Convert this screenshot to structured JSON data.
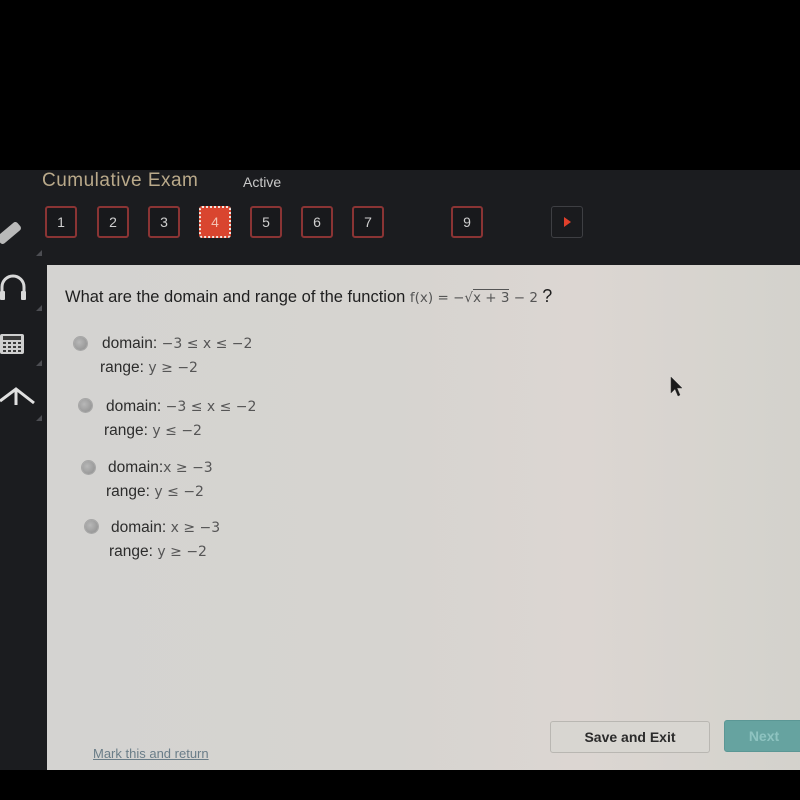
{
  "header": {
    "exam_title": "Cumulative Exam",
    "status": "Active"
  },
  "question_nav": {
    "items": [
      {
        "label": "1",
        "active": false
      },
      {
        "label": "2",
        "active": false
      },
      {
        "label": "3",
        "active": false
      },
      {
        "label": "4",
        "active": true
      },
      {
        "label": "5",
        "active": false
      },
      {
        "label": "6",
        "active": false
      },
      {
        "label": "7",
        "active": false
      },
      {
        "label": "9",
        "active": false
      }
    ],
    "next_arrow_icon": "play-arrow-icon"
  },
  "sidebar": {
    "tools": [
      {
        "name": "pencil",
        "icon": "pencil-icon"
      },
      {
        "name": "headphones",
        "icon": "headphones-icon"
      },
      {
        "name": "calculator",
        "icon": "calculator-icon"
      },
      {
        "name": "reference",
        "icon": "compass-icon"
      }
    ]
  },
  "question": {
    "text": "What are the domain and range of the function",
    "function_prefix": "f(x) = −",
    "radicand": "x + 3",
    "function_suffix": " − 2",
    "end": "?"
  },
  "options": [
    {
      "domain_label": "domain:",
      "domain_value": " −3 ≤ x ≤ −2",
      "range_label": "range:",
      "range_value": " y ≥ −2"
    },
    {
      "domain_label": "domain:",
      "domain_value": " −3 ≤ x ≤ −2",
      "range_label": "range:",
      "range_value": " y ≤ −2"
    },
    {
      "domain_label": "domain:",
      "domain_value": "x ≥ −3",
      "range_label": "range:",
      "range_value": " y ≤ −2"
    },
    {
      "domain_label": "domain:",
      "domain_value": " x ≥ −3",
      "range_label": "range:",
      "range_value": " y ≥ −2"
    }
  ],
  "footer": {
    "mark_link": "Mark this and return",
    "save_exit": "Save and Exit",
    "next": "Next"
  },
  "colors": {
    "accent_red": "#d9452f",
    "next_teal": "#66a3a0",
    "header_bg": "#1b1c1f",
    "content_bg": "#d5d4d0"
  }
}
